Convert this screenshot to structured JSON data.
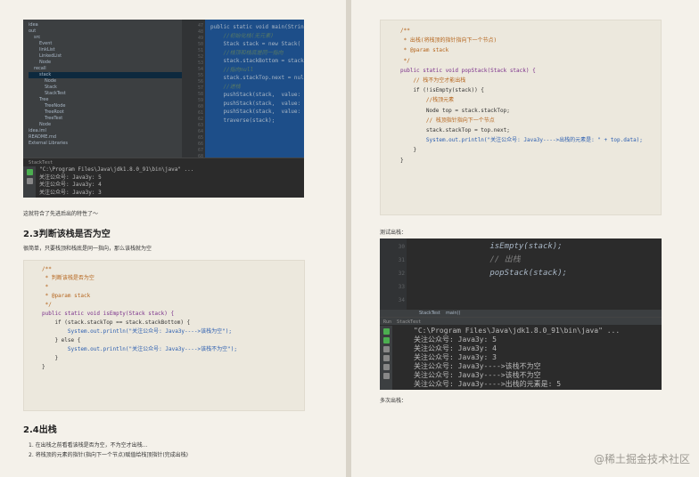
{
  "left_page": {
    "ide": {
      "tree_items": [
        "idea",
        "out",
        "src",
        "Event",
        "linkList",
        "LinkedList",
        "Node",
        "recall",
        "stack",
        "Node",
        "Stack",
        "StackTest",
        "Tree",
        "TreeNode",
        "TreeRoot",
        "TreeTest",
        "Node",
        "idea.iml",
        "README.md",
        "External Libraries"
      ],
      "line_numbers": [
        "47",
        "48",
        "49",
        "50",
        "51",
        "52",
        "53",
        "54",
        "55",
        "56",
        "57",
        "58",
        "59",
        "60",
        "61",
        "62",
        "63",
        "64",
        "65",
        "66",
        "67",
        "68"
      ],
      "code_lines": [
        {
          "text": "public static void main(Strin",
          "type": "code"
        },
        {
          "text": "",
          "type": "code"
        },
        {
          "text": "    //初始化栈(无元素)",
          "type": "comment"
        },
        {
          "text": "    Stack stack = new Stack(",
          "type": "code"
        },
        {
          "text": "",
          "type": "code"
        },
        {
          "text": "    //栈顶和栈底是同一指向",
          "type": "comment"
        },
        {
          "text": "    stack.stackBottom = stack",
          "type": "code"
        },
        {
          "text": "",
          "type": "code"
        },
        {
          "text": "    //指向null",
          "type": "comment"
        },
        {
          "text": "    stack.stackTop.next = null",
          "type": "code"
        },
        {
          "text": "",
          "type": "code"
        },
        {
          "text": "    //进栈",
          "type": "comment"
        },
        {
          "text": "    pushStack(stack,  value: 3)",
          "type": "code"
        },
        {
          "text": "    pushStack(stack,  value: 4)",
          "type": "code"
        },
        {
          "text": "    pushStack(stack,  value: 5)",
          "type": "code"
        },
        {
          "text": "",
          "type": "code"
        },
        {
          "text": "    traverse(stack);",
          "type": "code"
        }
      ],
      "console_title": "StackTest",
      "console_lines": [
        "\"C:\\Program Files\\Java\\jdk1.8.0_91\\bin\\java\" ...",
        "关注公众号: Java3y: 5",
        "关注公众号: Java3y: 4",
        "关注公众号: Java3y: 3"
      ]
    },
    "caption": "这就符合了先进后出的特性了～",
    "section_23": {
      "heading": "2.3判断该栈是否为空",
      "description": "很简单，只要栈顶和栈底是同一指向，那么该栈就为空",
      "code": [
        "/**",
        " * 判断该栈是否为空",
        " *",
        " * @param stack",
        " */",
        "public static void isEmpty(Stack stack) {",
        "    if (stack.stackTop == stack.stackBottom) {",
        "",
        "        System.out.println(\"关注公众号: Java3y---->该栈为空\");",
        "    } else {",
        "",
        "        System.out.println(\"关注公众号: Java3y---->该栈不为空\");",
        "",
        "    }",
        "",
        "}"
      ]
    },
    "section_24": {
      "heading": "2.4出栈",
      "steps": [
        "1. 在出栈之前看看该栈是否为空，不为空才出栈...",
        "2. 将栈顶的元素的指针(指向下一个节点)赋值给栈顶指针(完成出栈)"
      ]
    }
  },
  "right_page": {
    "code": [
      "/**",
      " * 出栈(将栈顶的指针指向下一个节点)",
      " * @param stack",
      " */",
      "public static void popStack(Stack stack) {",
      "",
      "    // 栈不为空才能出栈",
      "    if (!isEmpty(stack)) {",
      "",
      "        //栈顶元素",
      "        Node top = stack.stackTop;",
      "",
      "        // 栈顶指针指向下一个节点",
      "        stack.stackTop = top.next;",
      "",
      "        System.out.println(\"关注公众号: Java3y---->出栈的元素是: \" + top.data);",
      "",
      "    }",
      "}"
    ],
    "caption1": "测试出栈：",
    "ide": {
      "line_numbers": [
        "30",
        "31",
        "32",
        "33",
        "34"
      ],
      "code_lines": [
        "        isEmpty(stack);",
        "",
        "        // 出栈",
        "        popStack(stack);",
        "",
        ""
      ],
      "breadcrumb": "StackTest    main()",
      "console_title": "Run  StackTest",
      "console_lines": [
        "\"C:\\Program Files\\Java\\jdk1.8.0_91\\bin\\java\" ...",
        "关注公众号: Java3y: 5",
        "关注公众号: Java3y: 4",
        "关注公众号: Java3y: 3",
        "关注公众号: Java3y---->该栈不为空",
        "关注公众号: Java3y---->该栈不为空",
        "关注公众号: Java3y---->出栈的元素是: 5"
      ]
    },
    "caption2": "多次出栈："
  },
  "watermark": "@稀土掘金技术社区",
  "colors": {
    "ide_bg": "#2b2b2b",
    "ide_panel": "#3c3f41",
    "editor_highlight": "#1d4e89",
    "page_bg": "#f4f1ea",
    "code_bg": "#ece8dd",
    "run_icon": "#4caf50"
  }
}
